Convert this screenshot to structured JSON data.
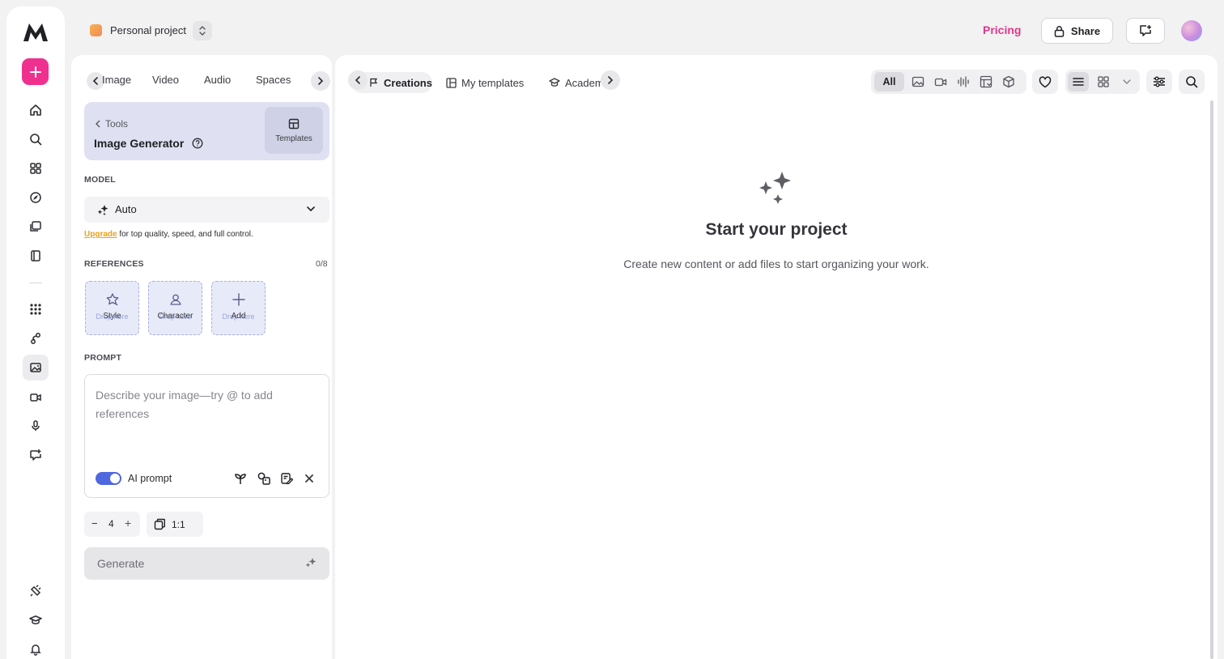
{
  "topbar": {
    "project_name": "Personal project",
    "pricing_label": "Pricing",
    "share_label": "Share"
  },
  "panel": {
    "tabs": [
      "Image",
      "Video",
      "Audio",
      "Spaces"
    ],
    "tools": {
      "breadcrumb": "Tools",
      "title": "Image Generator",
      "templates_label": "Templates"
    },
    "model": {
      "section_label": "MODEL",
      "value": "Auto",
      "upgrade_link": "Upgrade",
      "upgrade_text": " for top quality, speed, and full control."
    },
    "references": {
      "section_label": "REFERENCES",
      "count": "0/8",
      "items": [
        {
          "label": "Style",
          "ghost": "Drop here"
        },
        {
          "label": "Character",
          "ghost": "Drop here"
        },
        {
          "label": "Add",
          "ghost": "Drop here"
        }
      ]
    },
    "prompt": {
      "section_label": "PROMPT",
      "placeholder": "Describe your image—try @ to add references",
      "ai_prompt_label": "AI prompt",
      "ai_prompt_enabled": true
    },
    "count": {
      "minus": "−",
      "value": "4",
      "plus": "+"
    },
    "ratio": "1:1",
    "generate_label": "Generate"
  },
  "main": {
    "tabs": [
      "Creations",
      "My templates",
      "Academy"
    ],
    "filter_all": "All",
    "empty_title": "Start your project",
    "empty_subtitle": "Create new content or add files to start organizing your work."
  },
  "colors": {
    "accent_pink": "#f0308f",
    "pricing": "#e0368a",
    "upgrade": "#e8a21e",
    "toggle": "#4f67df",
    "tools_card": "#dfe1f2"
  },
  "icons": {
    "rail": [
      "home-icon",
      "search-icon",
      "apps-icon",
      "compass-icon",
      "library-icon",
      "book-icon",
      "grid-icon",
      "nodes-icon",
      "image-icon",
      "video-icon",
      "microphone-icon",
      "feedback-icon",
      "plugin-icon",
      "academy-icon",
      "bell-icon"
    ]
  }
}
